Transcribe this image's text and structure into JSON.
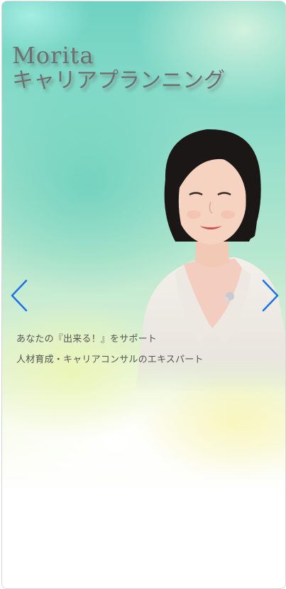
{
  "hero": {
    "brand_line1": "Morita",
    "brand_line2": "キャリアプランニング",
    "tagline_1": "あなたの『出来る！』をサポート",
    "tagline_2": "人材育成・キャリアコンサルのエキスパート"
  },
  "carousel": {
    "prev_icon": "chevron-left-icon",
    "next_icon": "chevron-right-icon",
    "arrow_color": "#1a73e8"
  },
  "colors": {
    "brand_text": "#6f6f6f",
    "tagline_text": "#555555",
    "background_top": "#6fd2c2",
    "background_bottom": "#ffffff"
  }
}
